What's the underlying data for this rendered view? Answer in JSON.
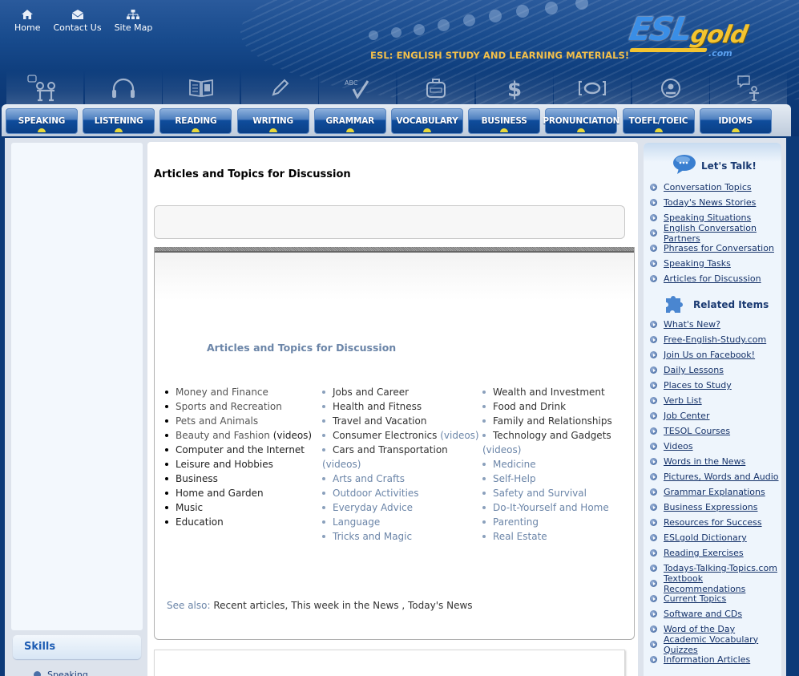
{
  "header": {
    "top_links": [
      {
        "label": "Home",
        "icon": "home-icon"
      },
      {
        "label": "Contact Us",
        "icon": "envelope-icon"
      },
      {
        "label": "Site Map",
        "icon": "sitemap-icon"
      }
    ],
    "tagline": "ESL: ENGLISH STUDY AND LEARNING MATERIALS!",
    "logo": {
      "main": "ESL",
      "accent": "gold",
      "suffix": ".com"
    },
    "colors": {
      "tagline": "#f3c04a",
      "header_bg": "#0e3d7c",
      "nav_button": "#0f4d9c"
    }
  },
  "nav": {
    "items": [
      {
        "label": "SPEAKING",
        "icon": "people-talking-icon"
      },
      {
        "label": "LISTENING",
        "icon": "headphones-icon"
      },
      {
        "label": "READING",
        "icon": "open-book-icon"
      },
      {
        "label": "WRITING",
        "icon": "pencil-icon"
      },
      {
        "label": "GRAMMAR",
        "icon": "abc-check-icon"
      },
      {
        "label": "VOCABULARY",
        "icon": "briefcase-icon"
      },
      {
        "label": "BUSINESS",
        "icon": "dollar-icon"
      },
      {
        "label": "PRONUNCIATION",
        "icon": "lips-icon"
      },
      {
        "label": "TOEFL/TOEIC",
        "icon": "person-circle-icon"
      },
      {
        "label": "IDIOMS",
        "icon": "person-speech-icon"
      }
    ]
  },
  "left": {
    "skills_heading": "Skills",
    "skills_items": [
      "Speaking"
    ]
  },
  "main": {
    "page_title": "Articles and Topics for Discussion",
    "subtitle": "Articles and Topics for Discussion",
    "columns": [
      [
        {
          "text": "Money and Finance",
          "style": "gray"
        },
        {
          "text": "Sports and Recreation",
          "style": "gray"
        },
        {
          "text": "Pets and Animals",
          "style": "gray"
        },
        {
          "text": "Beauty and Fashion",
          "style": "gray",
          "extra": " (videos)",
          "extra_style": "dark"
        },
        {
          "text": "Computer and the Internet",
          "style": "dark"
        },
        {
          "text": "Leisure and Hobbies",
          "style": "dark"
        },
        {
          "text": "Business",
          "style": "dark"
        },
        {
          "text": "Home and Garden",
          "style": "dark"
        },
        {
          "text": "Music",
          "style": "dark"
        },
        {
          "text": "Education",
          "style": "dark"
        }
      ],
      [
        {
          "text": "Jobs and Career",
          "style": "mid"
        },
        {
          "text": "Health and Fitness",
          "style": "mid"
        },
        {
          "text": "Travel and Vacation",
          "style": "mid"
        },
        {
          "text": "Consumer Electronics",
          "style": "mid",
          "extra": " (videos)",
          "extra_style": "blue"
        },
        {
          "text": "Cars and Transportation",
          "style": "mid"
        },
        {
          "text": "(videos)",
          "style": "blue",
          "continuation": true
        },
        {
          "text": "Arts and Crafts",
          "style": "blue"
        },
        {
          "text": "Outdoor Activities",
          "style": "blue"
        },
        {
          "text": "Everyday Advice",
          "style": "blue"
        },
        {
          "text": "Language",
          "style": "blue"
        },
        {
          "text": "Tricks and Magic",
          "style": "blue"
        }
      ],
      [
        {
          "text": "Wealth and Investment",
          "style": "mid"
        },
        {
          "text": "Food and Drink",
          "style": "mid"
        },
        {
          "text": "Family and Relationships",
          "style": "mid"
        },
        {
          "text": "Technology and Gadgets",
          "style": "mid"
        },
        {
          "text": "(videos)",
          "style": "blue",
          "continuation": true
        },
        {
          "text": "Medicine",
          "style": "blue"
        },
        {
          "text": "Self-Help",
          "style": "blue"
        },
        {
          "text": "Safety and Survival",
          "style": "blue"
        },
        {
          "text": "Do-It-Yourself and Home",
          "style": "blue"
        },
        {
          "text": "Parenting",
          "style": "blue"
        },
        {
          "text": "Real Estate",
          "style": "blue"
        }
      ]
    ],
    "see_also": {
      "label": "See also:",
      "links": [
        "Recent articles",
        "This week in the News ",
        "Today's News"
      ]
    }
  },
  "right": {
    "lets_talk": {
      "heading": "Let's Talk!",
      "items": [
        "Conversation Topics",
        "Today's News Stories",
        "Speaking Situations",
        "English Conversation Partners",
        "Phrases for Conversation",
        "Speaking Tasks",
        "Articles for Discussion"
      ]
    },
    "related": {
      "heading": "Related Items",
      "items": [
        "What's New?",
        "Free-English-Study.com",
        "Join Us on Facebook!",
        "Daily Lessons",
        "Places to Study",
        "Verb List",
        "Job Center",
        "TESOL Courses",
        "Videos",
        "Words in the News",
        "Pictures, Words and Audio",
        "Grammar Explanations",
        "Business Expressions",
        "Resources for Success",
        "ESLgold Dictionary",
        "Reading Exercises",
        "Todays-Talking-Topics.com",
        "Textbook Recommendations",
        "Current Topics",
        "Software and CDs",
        "Word of the Day",
        "Academic Vocabulary Quizzes",
        "Information Articles"
      ]
    }
  }
}
